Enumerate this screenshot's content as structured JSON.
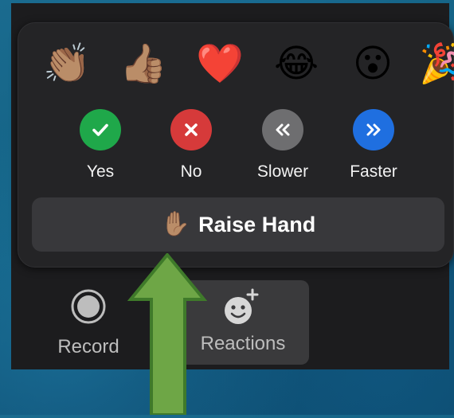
{
  "reactions_popover": {
    "emojis": [
      {
        "name": "clapping-hands",
        "glyph": "👏🏽"
      },
      {
        "name": "thumbs-up",
        "glyph": "👍🏽"
      },
      {
        "name": "heart",
        "glyph": "❤️"
      },
      {
        "name": "tears-of-joy",
        "glyph": "😂"
      },
      {
        "name": "open-mouth",
        "glyph": "😮"
      },
      {
        "name": "party-popper",
        "glyph": "🎉"
      }
    ],
    "feedback": {
      "yes_label": "Yes",
      "no_label": "No",
      "slower_label": "Slower",
      "faster_label": "Faster"
    },
    "feedback_colors": {
      "yes": "#1fa84a",
      "no": "#d63a3a",
      "slower": "#6e6e70",
      "faster": "#1f6fe0"
    },
    "raise_hand": {
      "glyph": "✋🏽",
      "label": "Raise Hand"
    }
  },
  "toolbar": {
    "record_label": "Record",
    "reactions_label": "Reactions"
  },
  "annotation": {
    "arrow_color": "#6ea646",
    "arrow_border": "#3f7a2a"
  }
}
